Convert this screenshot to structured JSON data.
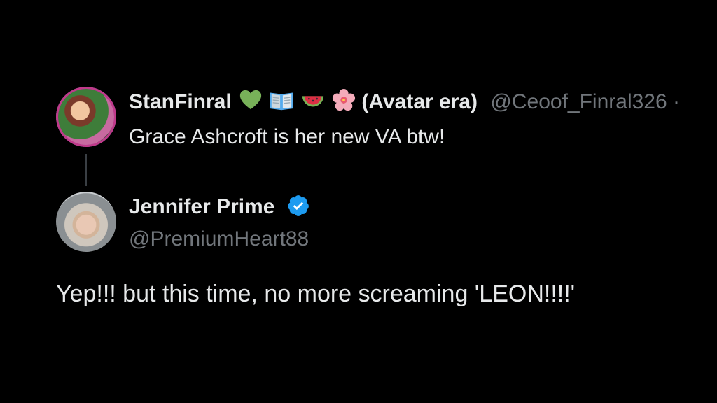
{
  "parent_tweet": {
    "display_name": "StanFinral",
    "emojis": [
      "green-heart-icon",
      "open-book-icon",
      "watermelon-icon",
      "cherry-blossom-icon"
    ],
    "name_suffix": "(Avatar era)",
    "handle": "@Ceoof_Finral326 ·",
    "text": "Grace Ashcroft is her new VA btw!"
  },
  "reply_tweet": {
    "display_name": "Jennifer Prime",
    "verified": true,
    "handle": "@PremiumHeart88",
    "text": "Yep!!! but this time, no more screaming 'LEON!!!!'"
  },
  "colors": {
    "background": "#000000",
    "text_primary": "#e7e9ea",
    "text_secondary": "#71767b",
    "verified_blue": "#1d9bf0",
    "connector": "#3a3f44"
  }
}
